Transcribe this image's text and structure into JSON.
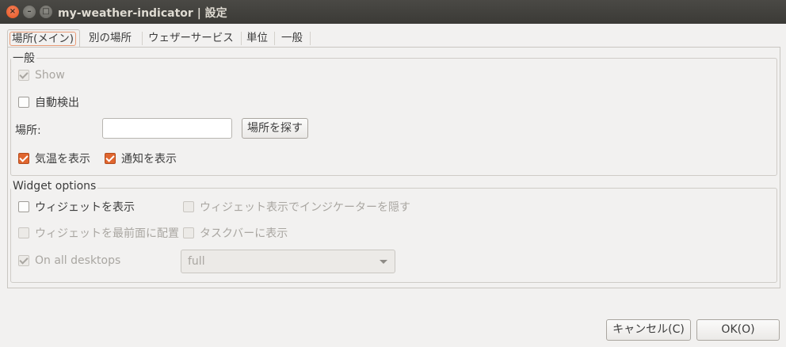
{
  "window": {
    "title": "my-weather-indicator | 設定",
    "close_glyph": "×",
    "minimize_glyph": "–",
    "maximize_glyph": "□"
  },
  "tabs": [
    {
      "label": "場所(メイン)",
      "active": true
    },
    {
      "label": "別の場所",
      "active": false
    },
    {
      "label": "ウェザーサービス",
      "active": false
    },
    {
      "label": "単位",
      "active": false
    },
    {
      "label": "一般",
      "active": false
    }
  ],
  "general": {
    "frame_label": "一般",
    "show": {
      "label": "Show",
      "checked": true,
      "enabled": false
    },
    "autodetect": {
      "label": "自動検出",
      "checked": false,
      "enabled": true
    },
    "location_label": "場所:",
    "location_value": "",
    "find_button": "場所を探す",
    "show_temp": {
      "label": "気温を表示",
      "checked": true,
      "enabled": true
    },
    "show_notif": {
      "label": "通知を表示",
      "checked": true,
      "enabled": true
    }
  },
  "widget": {
    "frame_label": "Widget options",
    "show_widget": {
      "label": "ウィジェットを表示",
      "checked": false,
      "enabled": true
    },
    "hide_indicator": {
      "label": "ウィジェット表示でインジケーターを隠す",
      "checked": false,
      "enabled": false
    },
    "on_top": {
      "label": "ウィジェットを最前面に配置",
      "checked": false,
      "enabled": false
    },
    "taskbar": {
      "label": "タスクバーに表示",
      "checked": false,
      "enabled": false
    },
    "all_desktops": {
      "label": "On all desktops",
      "checked": true,
      "enabled": false
    },
    "skin_value": "full"
  },
  "buttons": {
    "cancel": "キャンセル(C)",
    "ok": "OK(O)"
  },
  "colors": {
    "accent": "#e0662f",
    "titlebar": "#3b3a36",
    "background": "#f2f1f0"
  }
}
